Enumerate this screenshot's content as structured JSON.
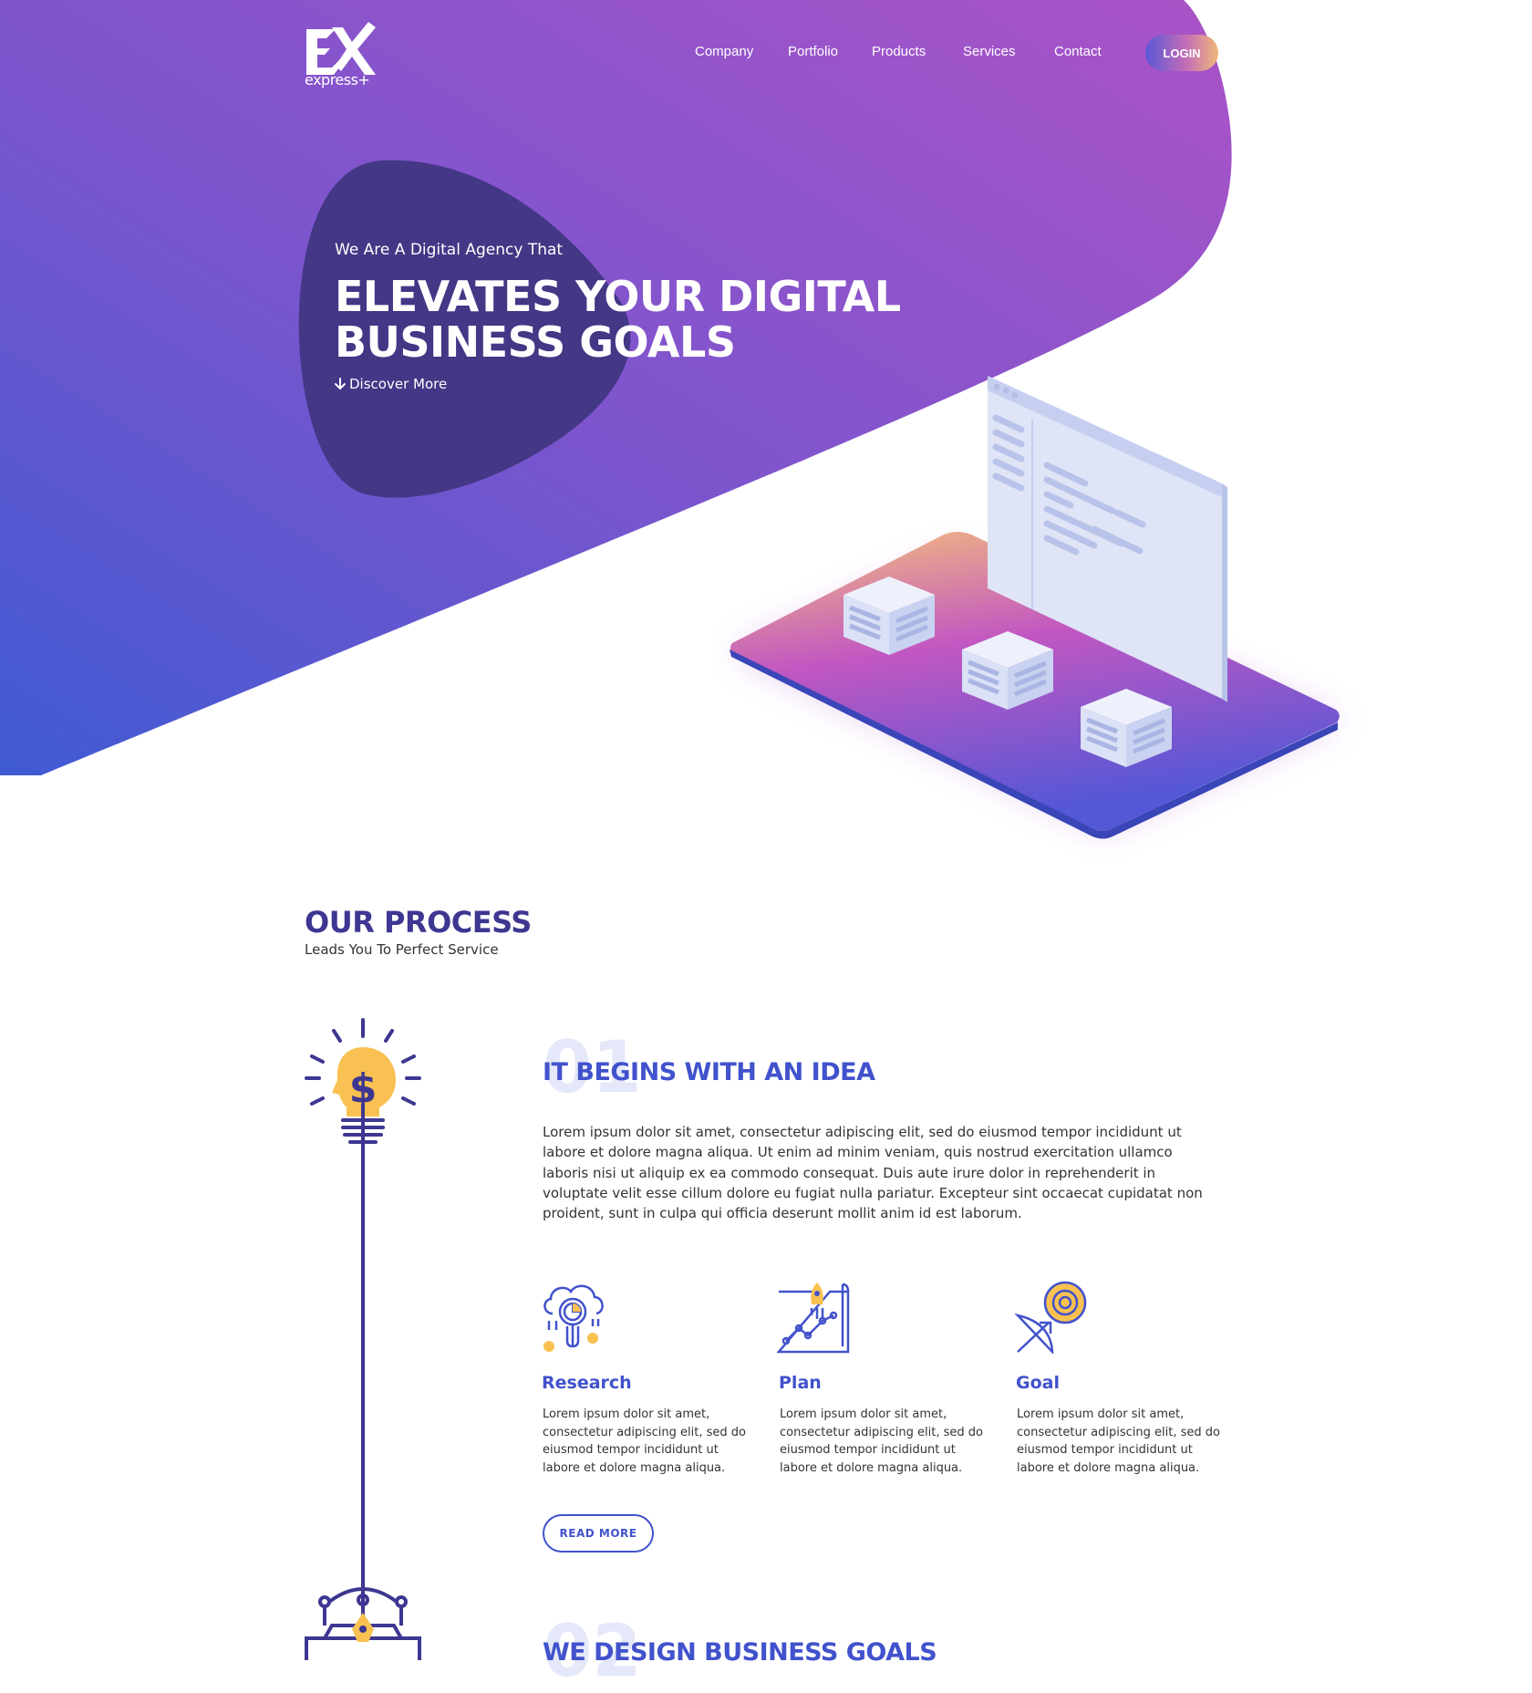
{
  "brand": {
    "logo_text": "express+"
  },
  "nav": {
    "items": [
      "Company",
      "Portfolio",
      "Products",
      "Services",
      "Contact"
    ],
    "login": "LOGIN"
  },
  "hero": {
    "subtitle": "We Are A Digital Agency That",
    "title_line1": "ELEVATES YOUR DIGITAL",
    "title_line2": "BUSINESS GOALS",
    "discover": "Discover More"
  },
  "process": {
    "title": "OUR PROCESS",
    "subtitle": "Leads You To Perfect Service",
    "steps": [
      {
        "number": "01",
        "title": "IT BEGINS WITH AN IDEA",
        "description": "Lorem ipsum dolor sit amet, consectetur adipiscing elit, sed do eiusmod tempor incididunt ut labore et dolore magna aliqua. Ut enim ad minim veniam, quis nostrud exercitation ullamco laboris nisi ut aliquip ex ea commodo consequat. Duis aute irure dolor in reprehenderit in voluptate velit esse cillum dolore eu fugiat nulla pariatur. Excepteur sint occaecat cupidatat non proident, sunt in culpa qui officia deserunt mollit anim id est laborum."
      },
      {
        "number": "02",
        "title": "WE DESIGN BUSINESS GOALS"
      }
    ],
    "features": [
      {
        "icon": "research-icon",
        "title": "Research",
        "text": "Lorem ipsum dolor sit amet, consectetur adipiscing elit, sed do eiusmod tempor incididunt ut labore et dolore magna aliqua."
      },
      {
        "icon": "plan-icon",
        "title": "Plan",
        "text": "Lorem ipsum dolor sit amet, consectetur adipiscing elit, sed do eiusmod tempor incididunt ut labore et dolore magna aliqua."
      },
      {
        "icon": "goal-icon",
        "title": "Goal",
        "text": "Lorem ipsum dolor sit amet, consectetur adipiscing elit, sed do eiusmod tempor incididunt ut labore et dolore magna aliqua."
      }
    ],
    "read_more": "READ MORE"
  },
  "colors": {
    "gradient_start": "#4458d2",
    "gradient_mid": "#7b55cc",
    "gradient_end": "#a655c8",
    "blob": "#433786",
    "primary": "#4152cc",
    "heading_dark": "#3d3791",
    "accent_yellow": "#f9c152",
    "accent_orange": "#f0b77a"
  }
}
